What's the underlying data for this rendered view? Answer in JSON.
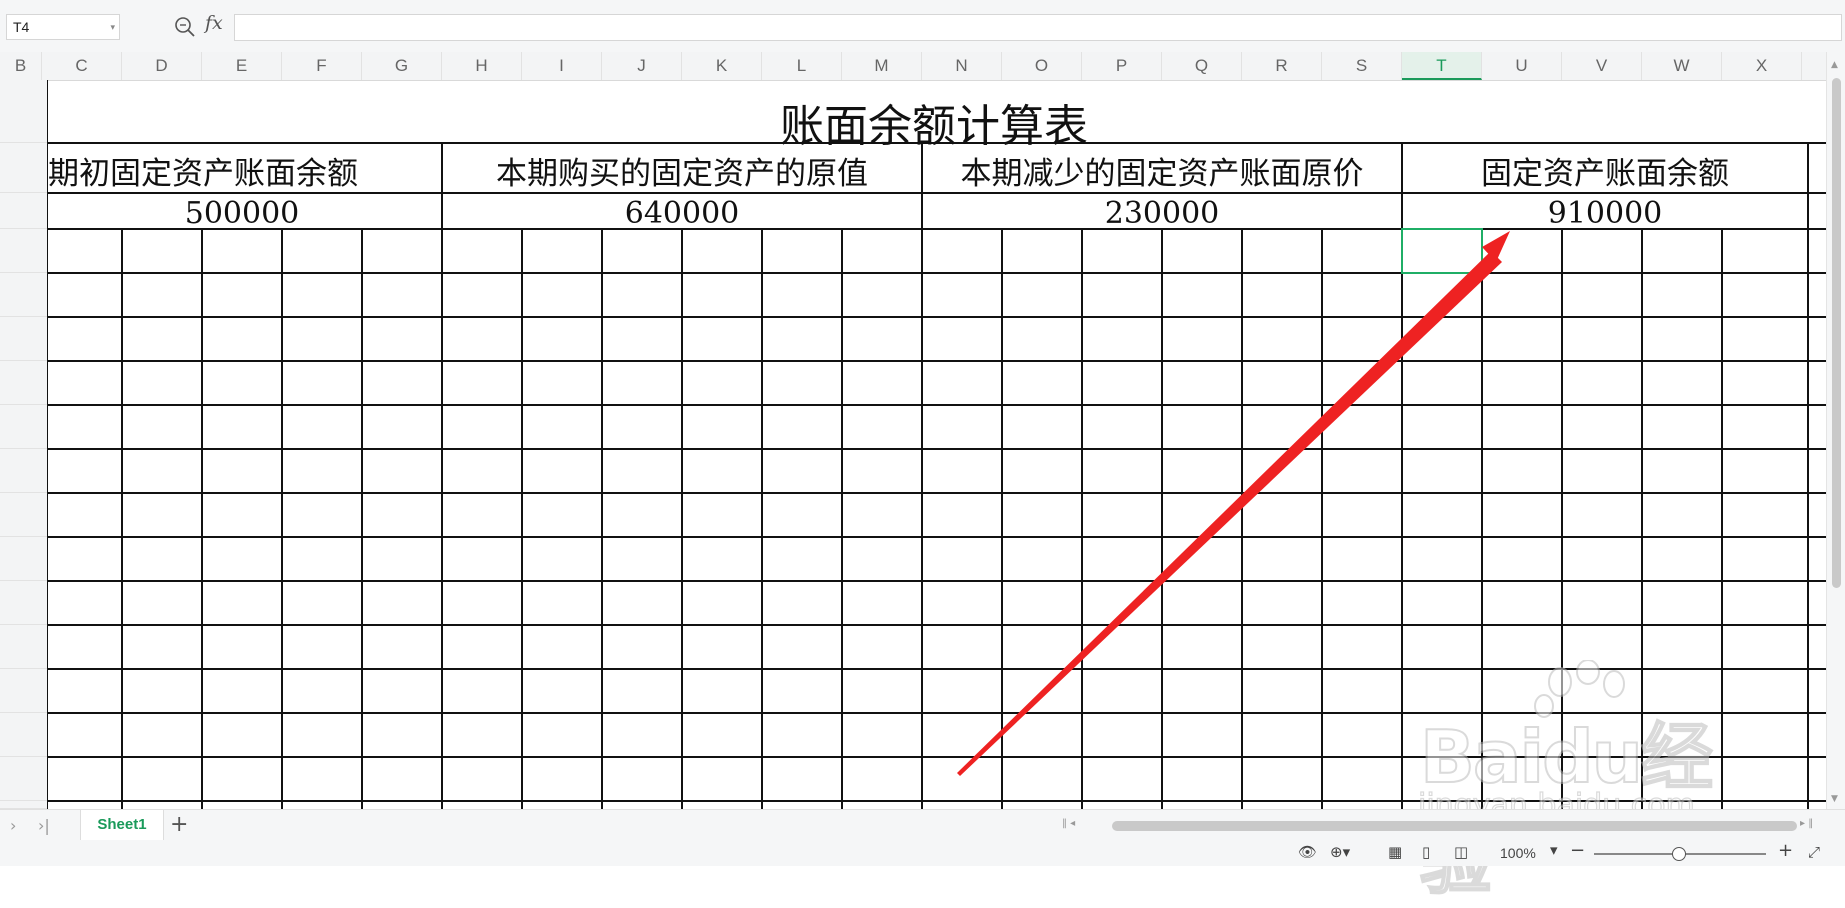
{
  "formula_bar": {
    "cell_ref": "T4",
    "fx_label": "fx",
    "formula": ""
  },
  "columns": [
    "B",
    "C",
    "D",
    "E",
    "F",
    "G",
    "H",
    "I",
    "J",
    "K",
    "L",
    "M",
    "N",
    "O",
    "P",
    "Q",
    "R",
    "S",
    "T",
    "U",
    "V",
    "W",
    "X"
  ],
  "active_column": "T",
  "sheet": {
    "title": "账面余额计算表",
    "headers": [
      "期初固定资产账面余额",
      "本期购买的固定资产的原值",
      "本期减少的固定资产账面原价",
      "固定资产账面余额"
    ],
    "values": [
      "500000",
      "640000",
      "230000",
      "910000"
    ]
  },
  "selected_cell": "T4",
  "tabs": {
    "sheet_name": "Sheet1"
  },
  "status": {
    "zoom": "100%"
  },
  "watermark": {
    "brand": "Baidu经验",
    "url": "jingyan.baidu.com"
  },
  "colors": {
    "accent": "#1a9a5a",
    "selection": "#1fae66",
    "arrow": "#ee2222"
  }
}
